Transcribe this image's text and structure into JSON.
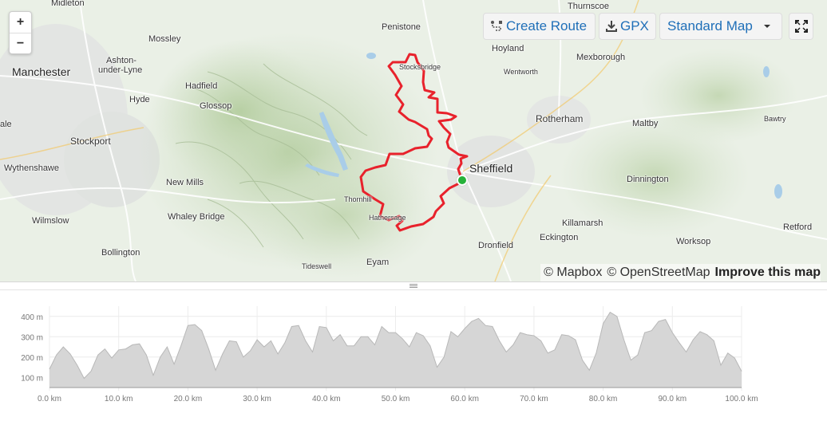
{
  "map": {
    "zoom_in": "+",
    "zoom_out": "−",
    "create_route": "Create Route",
    "gpx": "GPX",
    "map_style": "Standard Map",
    "attribution": {
      "mapbox": "© Mapbox",
      "osm": "© OpenStreetMap",
      "improve": "Improve this map"
    },
    "places": {
      "midleton": "Midleton",
      "thurnscoe": "Thurnscoe",
      "mossley": "Mossley",
      "penistone": "Penistone",
      "hoyland": "Hoyland",
      "mexborough": "Mexborough",
      "manchester": "Manchester",
      "ashton1": "Ashton-",
      "ashton2": "under-Lyne",
      "stocksbridge": "Stocksbridge",
      "wentworth": "Wentworth",
      "hadfield": "Hadfield",
      "hyde": "Hyde",
      "glossop": "Glossop",
      "rotherham": "Rotherham",
      "maltby": "Maltby",
      "bawtry": "Bawtry",
      "sale": "ale",
      "stockport": "Stockport",
      "sheffield": "Sheffield",
      "wythenshawe": "Wythenshawe",
      "new_mills": "New Mills",
      "dinnington": "Dinnington",
      "thornhill": "Thornhill",
      "wilmslow": "Wilmslow",
      "whaley_bridge": "Whaley Bridge",
      "hathersage": "Hathersage",
      "killamarsh": "Killamarsh",
      "eckington": "Eckington",
      "retford": "Retford",
      "bollington": "Bollington",
      "dronfield": "Dronfield",
      "worksop": "Worksop",
      "tideswell": "Tideswell",
      "eyam": "Eyam"
    },
    "route_color": "#e8222c",
    "start_color": "#26b23a"
  },
  "chart_data": {
    "type": "area",
    "xlabel": "",
    "ylabel": "",
    "x_unit": "km",
    "y_unit": "m",
    "xlim": [
      0,
      100
    ],
    "ylim": [
      50,
      450
    ],
    "x_ticks": [
      "0.0 km",
      "10.0 km",
      "20.0 km",
      "30.0 km",
      "40.0 km",
      "50.0 km",
      "60.0 km",
      "70.0 km",
      "80.0 km",
      "90.0 km",
      "100.0 km"
    ],
    "y_ticks": [
      "100 m",
      "200 m",
      "300 m",
      "400 m"
    ],
    "fill_color": "#d6d6d6",
    "line_color": "#b8b8b8",
    "x": [
      0,
      1,
      2,
      3,
      4,
      5,
      6,
      7,
      8,
      9,
      10,
      11,
      12,
      13,
      14,
      15,
      16,
      17,
      18,
      19,
      20,
      21,
      22,
      23,
      24,
      25,
      26,
      27,
      28,
      29,
      30,
      31,
      32,
      33,
      34,
      35,
      36,
      37,
      38,
      39,
      40,
      41,
      42,
      43,
      44,
      45,
      46,
      47,
      48,
      49,
      50,
      51,
      52,
      53,
      54,
      55,
      56,
      57,
      58,
      59,
      60,
      61,
      62,
      63,
      64,
      65,
      66,
      67,
      68,
      69,
      70,
      71,
      72,
      73,
      74,
      75,
      76,
      77,
      78,
      79,
      80,
      81,
      82,
      83,
      84,
      85,
      86,
      87,
      88,
      89,
      90,
      91,
      92,
      93,
      94,
      95,
      96,
      97,
      98,
      99,
      100
    ],
    "y": [
      140,
      210,
      250,
      215,
      160,
      95,
      130,
      210,
      240,
      195,
      235,
      240,
      260,
      265,
      210,
      110,
      200,
      250,
      165,
      255,
      355,
      360,
      330,
      240,
      135,
      215,
      280,
      275,
      200,
      230,
      285,
      250,
      280,
      215,
      270,
      350,
      355,
      280,
      225,
      350,
      345,
      280,
      310,
      255,
      255,
      300,
      300,
      260,
      350,
      320,
      320,
      290,
      250,
      320,
      305,
      255,
      150,
      200,
      325,
      300,
      340,
      375,
      390,
      355,
      350,
      280,
      225,
      260,
      320,
      310,
      305,
      280,
      220,
      235,
      310,
      305,
      285,
      185,
      135,
      220,
      365,
      420,
      400,
      285,
      185,
      210,
      320,
      330,
      375,
      385,
      320,
      270,
      225,
      285,
      325,
      310,
      280,
      160,
      220,
      195,
      130
    ]
  }
}
